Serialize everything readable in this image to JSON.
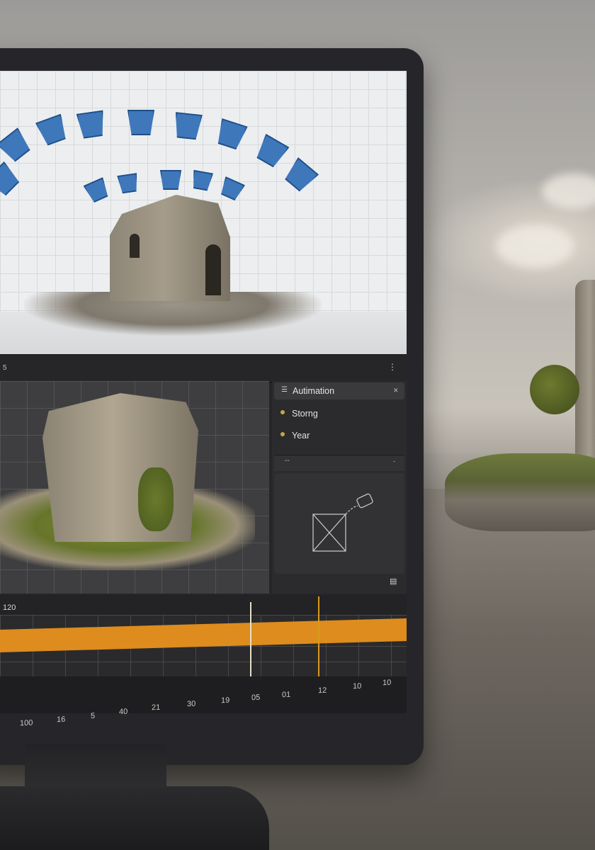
{
  "toolbar": {
    "left_text": "5",
    "menu_icon": "more-vertical-icon"
  },
  "panel": {
    "title": "Autimation",
    "title_icon": "list-icon",
    "close_icon": "close-icon",
    "items": [
      {
        "label": "Storng"
      },
      {
        "label": "Year"
      }
    ],
    "divider_left": "--",
    "divider_right": "-",
    "preview_icon": "camera-frame-icon"
  },
  "timeline": {
    "frame_label": "120",
    "menu_icon": "menu-icon",
    "upper_ruler": [
      "05",
      "01",
      "12",
      "10",
      "10"
    ],
    "lower_ruler": [
      "100",
      "16",
      "5",
      "40",
      "21",
      "30",
      "19"
    ]
  },
  "colors": {
    "accent_orange": "#dd8c1d",
    "camera_blue": "#3f77bb",
    "panel_bg": "#2b2b2d"
  }
}
